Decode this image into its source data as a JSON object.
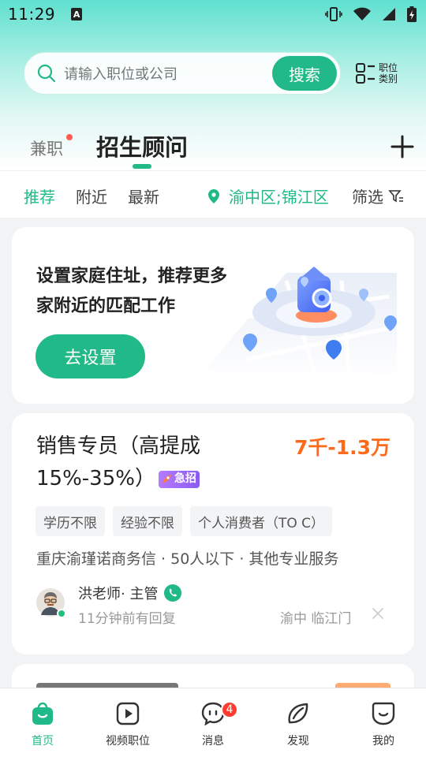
{
  "status_bar": {
    "time": "11:29",
    "notif_letter": "A"
  },
  "search": {
    "placeholder": "请输入职位或公司",
    "button_label": "搜索",
    "category_label": "职位类别"
  },
  "tabs": {
    "part_time": "兼职",
    "main": "招生顾问"
  },
  "filters": {
    "recommend": "推荐",
    "nearby": "附近",
    "latest": "最新",
    "location": "渝中区;锦江区",
    "screen": "筛选"
  },
  "promo": {
    "text": "设置家庭住址，推荐更多家附近的匹配工作",
    "button_label": "去设置"
  },
  "job": {
    "title": "销售专员（高提成15%-35%）",
    "urgent_badge": "急招",
    "salary": "7千-1.3万",
    "tags": [
      "学历不限",
      "经验不限",
      "个人消费者（TO C）"
    ],
    "company_line": "重庆渝瑾诺商务信 · 50人以下 · 其他专业服务",
    "recruiter": "洪老师· 主管",
    "reply_time": "11分钟前有回复",
    "location": "渝中 临江门"
  },
  "nav": {
    "items": [
      {
        "label": "首页",
        "icon": "home-bag-icon"
      },
      {
        "label": "视频职位",
        "icon": "video-play-icon"
      },
      {
        "label": "消息",
        "icon": "chat-bubble-icon",
        "badge": "4"
      },
      {
        "label": "发现",
        "icon": "discover-leaf-icon"
      },
      {
        "label": "我的",
        "icon": "profile-face-icon"
      }
    ]
  },
  "colors": {
    "accent": "#21b987",
    "salary": "#ff6a1a",
    "badge": "#ff3b30"
  }
}
